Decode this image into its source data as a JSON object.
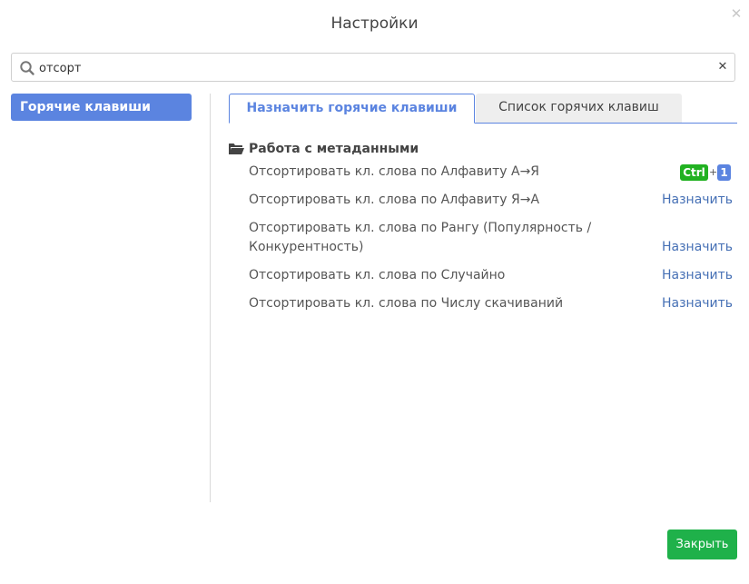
{
  "dialog": {
    "title": "Настройки",
    "close_icon": "close-icon"
  },
  "search": {
    "value": "отсорт",
    "placeholder": "",
    "icon": "search-icon",
    "clear_icon": "clear-icon"
  },
  "sidebar": {
    "items": [
      {
        "label": "Горячие клавиши",
        "active": true
      }
    ]
  },
  "tabs": [
    {
      "label": "Назначить горячие клавиши",
      "active": true
    },
    {
      "label": "Список горячих клавиш",
      "active": false
    }
  ],
  "group": {
    "label": "Работа с метаданными",
    "icon": "folder-open-icon",
    "rows": [
      {
        "label": "Отсортировать кл. слова по Алфавиту А→Я",
        "hotkey": {
          "modifier": "Ctrl",
          "plus": "+",
          "key": "1"
        }
      },
      {
        "label": "Отсортировать кл. слова по Алфавиту Я→А",
        "action": "Назначить"
      },
      {
        "label": "Отсортировать кл. слова по Рангу (Популярность / Конкурентность)",
        "action": "Назначить"
      },
      {
        "label": "Отсортировать кл. слова по Случайно",
        "action": "Назначить"
      },
      {
        "label": "Отсортировать кл. слова по Числу скачиваний",
        "action": "Назначить"
      }
    ]
  },
  "footer": {
    "close_label": "Закрыть"
  },
  "colors": {
    "accent": "#5b84e0",
    "link": "#4670b5",
    "success": "#1fb14a",
    "ctrl_key": "#21b121"
  }
}
